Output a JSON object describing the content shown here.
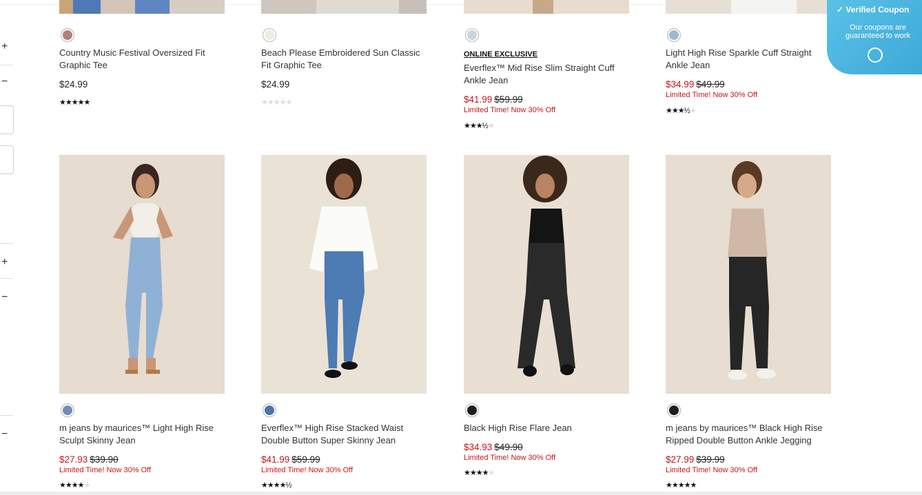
{
  "coupon": {
    "title": "Verified Coupon",
    "subtitle": "Our coupons are guaranteed to work",
    "icon": "check-circle-icon"
  },
  "sidebar": {
    "plus": "+",
    "minus": "−"
  },
  "top_row": [
    {
      "name": "Country Music Festival Oversized Fit Graphic Tee",
      "tag": "",
      "price": "$24.99",
      "sale": "",
      "orig": "",
      "promo": "",
      "stars": "★★★★★",
      "stars_off": "",
      "rating_count": 5,
      "swatch": "#b38172"
    },
    {
      "name": "Beach Please Embroidered Sun Classic Fit Graphic Tee",
      "tag": "",
      "price": "$24.99",
      "sale": "",
      "orig": "",
      "promo": "",
      "stars": "",
      "stars_off": "★★★★★",
      "rating_count": 0,
      "swatch": "#efece0"
    },
    {
      "name": "Everflex™ Mid Rise Slim Straight Cuff Ankle Jean",
      "tag": "ONLINE EXCLUSIVE",
      "price": "",
      "sale": "$41.99",
      "orig": "$59.99",
      "promo": "Limited Time! Now 30% Off",
      "stars": "★★★½",
      "stars_off": "★",
      "rating_count": 3.5,
      "swatch": "#c9d5de"
    },
    {
      "name": "Light High Rise Sparkle Cuff Straight Ankle Jean",
      "tag": "",
      "price": "",
      "sale": "$34.99",
      "orig": "$49.99",
      "promo": "Limited Time! Now 30% Off",
      "stars": "★★★½",
      "stars_off": "★",
      "rating_count": 3.5,
      "swatch": "#9fb8cc"
    }
  ],
  "bottom_row": [
    {
      "name": "m jeans by maurices™ Light High Rise Sculpt Skinny Jean",
      "sale": "$27.93",
      "orig": "$39.90",
      "promo": "Limited Time! Now 30% Off",
      "stars": "★★★★",
      "stars_off": "★",
      "rating_count": 4,
      "swatch": "#6f8fb7"
    },
    {
      "name": "Everflex™ High Rise Stacked Waist Double Button Super Skinny Jean",
      "sale": "$41.99",
      "orig": "$59.99",
      "promo": "Limited Time! Now 30% Off",
      "stars": "★★★★½",
      "stars_off": "",
      "rating_count": 4.5,
      "swatch": "#4f73a8"
    },
    {
      "name": "Black High Rise Flare Jean",
      "sale": "$34.93",
      "orig": "$49.90",
      "promo": "Limited Time! Now 30% Off",
      "stars": "★★★★",
      "stars_off": "★",
      "rating_count": 4,
      "swatch": "#1e1e1e"
    },
    {
      "name": "m jeans by maurices™ Black High Rise Ripped Double Button Ankle Jegging",
      "sale": "$27.99",
      "orig": "$39.99",
      "promo": "Limited Time! Now 30% Off",
      "stars": "★★★★★",
      "stars_off": "",
      "rating_count": 5,
      "swatch": "#1e1e1e"
    }
  ]
}
